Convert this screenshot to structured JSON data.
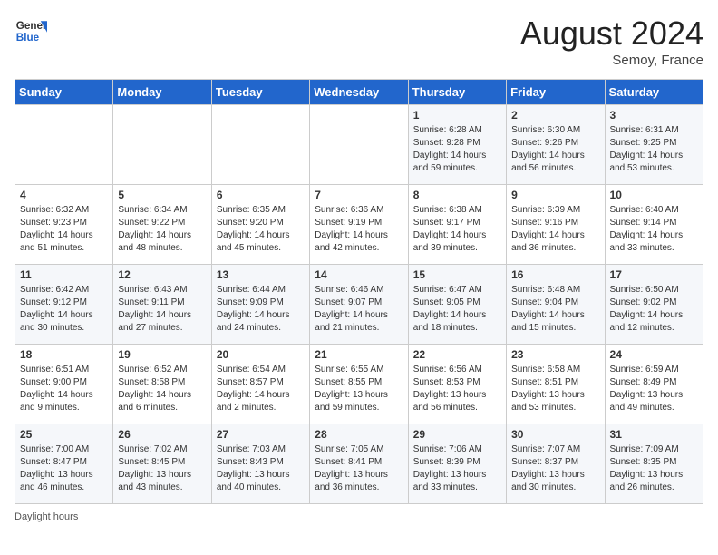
{
  "header": {
    "logo_line1": "General",
    "logo_line2": "Blue",
    "month_year": "August 2024",
    "location": "Semoy, France"
  },
  "days_of_week": [
    "Sunday",
    "Monday",
    "Tuesday",
    "Wednesday",
    "Thursday",
    "Friday",
    "Saturday"
  ],
  "weeks": [
    [
      {
        "day": "",
        "info": ""
      },
      {
        "day": "",
        "info": ""
      },
      {
        "day": "",
        "info": ""
      },
      {
        "day": "",
        "info": ""
      },
      {
        "day": "1",
        "sunrise": "6:28 AM",
        "sunset": "9:28 PM",
        "daylight": "14 hours and 59 minutes."
      },
      {
        "day": "2",
        "sunrise": "6:30 AM",
        "sunset": "9:26 PM",
        "daylight": "14 hours and 56 minutes."
      },
      {
        "day": "3",
        "sunrise": "6:31 AM",
        "sunset": "9:25 PM",
        "daylight": "14 hours and 53 minutes."
      }
    ],
    [
      {
        "day": "4",
        "sunrise": "6:32 AM",
        "sunset": "9:23 PM",
        "daylight": "14 hours and 51 minutes."
      },
      {
        "day": "5",
        "sunrise": "6:34 AM",
        "sunset": "9:22 PM",
        "daylight": "14 hours and 48 minutes."
      },
      {
        "day": "6",
        "sunrise": "6:35 AM",
        "sunset": "9:20 PM",
        "daylight": "14 hours and 45 minutes."
      },
      {
        "day": "7",
        "sunrise": "6:36 AM",
        "sunset": "9:19 PM",
        "daylight": "14 hours and 42 minutes."
      },
      {
        "day": "8",
        "sunrise": "6:38 AM",
        "sunset": "9:17 PM",
        "daylight": "14 hours and 39 minutes."
      },
      {
        "day": "9",
        "sunrise": "6:39 AM",
        "sunset": "9:16 PM",
        "daylight": "14 hours and 36 minutes."
      },
      {
        "day": "10",
        "sunrise": "6:40 AM",
        "sunset": "9:14 PM",
        "daylight": "14 hours and 33 minutes."
      }
    ],
    [
      {
        "day": "11",
        "sunrise": "6:42 AM",
        "sunset": "9:12 PM",
        "daylight": "14 hours and 30 minutes."
      },
      {
        "day": "12",
        "sunrise": "6:43 AM",
        "sunset": "9:11 PM",
        "daylight": "14 hours and 27 minutes."
      },
      {
        "day": "13",
        "sunrise": "6:44 AM",
        "sunset": "9:09 PM",
        "daylight": "14 hours and 24 minutes."
      },
      {
        "day": "14",
        "sunrise": "6:46 AM",
        "sunset": "9:07 PM",
        "daylight": "14 hours and 21 minutes."
      },
      {
        "day": "15",
        "sunrise": "6:47 AM",
        "sunset": "9:05 PM",
        "daylight": "14 hours and 18 minutes."
      },
      {
        "day": "16",
        "sunrise": "6:48 AM",
        "sunset": "9:04 PM",
        "daylight": "14 hours and 15 minutes."
      },
      {
        "day": "17",
        "sunrise": "6:50 AM",
        "sunset": "9:02 PM",
        "daylight": "14 hours and 12 minutes."
      }
    ],
    [
      {
        "day": "18",
        "sunrise": "6:51 AM",
        "sunset": "9:00 PM",
        "daylight": "14 hours and 9 minutes."
      },
      {
        "day": "19",
        "sunrise": "6:52 AM",
        "sunset": "8:58 PM",
        "daylight": "14 hours and 6 minutes."
      },
      {
        "day": "20",
        "sunrise": "6:54 AM",
        "sunset": "8:57 PM",
        "daylight": "14 hours and 2 minutes."
      },
      {
        "day": "21",
        "sunrise": "6:55 AM",
        "sunset": "8:55 PM",
        "daylight": "13 hours and 59 minutes."
      },
      {
        "day": "22",
        "sunrise": "6:56 AM",
        "sunset": "8:53 PM",
        "daylight": "13 hours and 56 minutes."
      },
      {
        "day": "23",
        "sunrise": "6:58 AM",
        "sunset": "8:51 PM",
        "daylight": "13 hours and 53 minutes."
      },
      {
        "day": "24",
        "sunrise": "6:59 AM",
        "sunset": "8:49 PM",
        "daylight": "13 hours and 49 minutes."
      }
    ],
    [
      {
        "day": "25",
        "sunrise": "7:00 AM",
        "sunset": "8:47 PM",
        "daylight": "13 hours and 46 minutes."
      },
      {
        "day": "26",
        "sunrise": "7:02 AM",
        "sunset": "8:45 PM",
        "daylight": "13 hours and 43 minutes."
      },
      {
        "day": "27",
        "sunrise": "7:03 AM",
        "sunset": "8:43 PM",
        "daylight": "13 hours and 40 minutes."
      },
      {
        "day": "28",
        "sunrise": "7:05 AM",
        "sunset": "8:41 PM",
        "daylight": "13 hours and 36 minutes."
      },
      {
        "day": "29",
        "sunrise": "7:06 AM",
        "sunset": "8:39 PM",
        "daylight": "13 hours and 33 minutes."
      },
      {
        "day": "30",
        "sunrise": "7:07 AM",
        "sunset": "8:37 PM",
        "daylight": "13 hours and 30 minutes."
      },
      {
        "day": "31",
        "sunrise": "7:09 AM",
        "sunset": "8:35 PM",
        "daylight": "13 hours and 26 minutes."
      }
    ]
  ],
  "footer": {
    "label": "Daylight hours"
  }
}
